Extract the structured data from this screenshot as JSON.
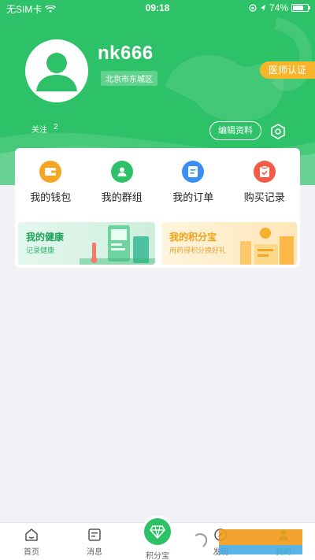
{
  "status_bar": {
    "carrier": "无SIM卡",
    "time": "09:18",
    "battery": "74%"
  },
  "profile": {
    "username": "nk666",
    "location": "北京市东城区",
    "doctor_badge": "医师认证",
    "follow_label": "关注",
    "follow_count": "2",
    "edit_label": "编辑资料"
  },
  "quick_actions": [
    {
      "label": "我的钱包",
      "icon": "wallet-icon",
      "color": "#f5a623"
    },
    {
      "label": "我的群组",
      "icon": "group-icon",
      "color": "#2ec268"
    },
    {
      "label": "我的订单",
      "icon": "order-icon",
      "color": "#3a8ef6"
    },
    {
      "label": "购买记录",
      "icon": "record-icon",
      "color": "#f45b48"
    }
  ],
  "promos": {
    "health": {
      "title": "我的健康",
      "subtitle": "记录健康"
    },
    "points": {
      "title": "我的积分宝",
      "subtitle": "用药得积分换好礼"
    }
  },
  "tabs": [
    {
      "label": "首页"
    },
    {
      "label": "消息"
    },
    {
      "label": "积分宝"
    },
    {
      "label": "发现"
    },
    {
      "label": "我的"
    }
  ],
  "colors": {
    "brand_green": "#2ec268",
    "badge_orange": "#f7b52c",
    "background": "#f2f2f6"
  }
}
